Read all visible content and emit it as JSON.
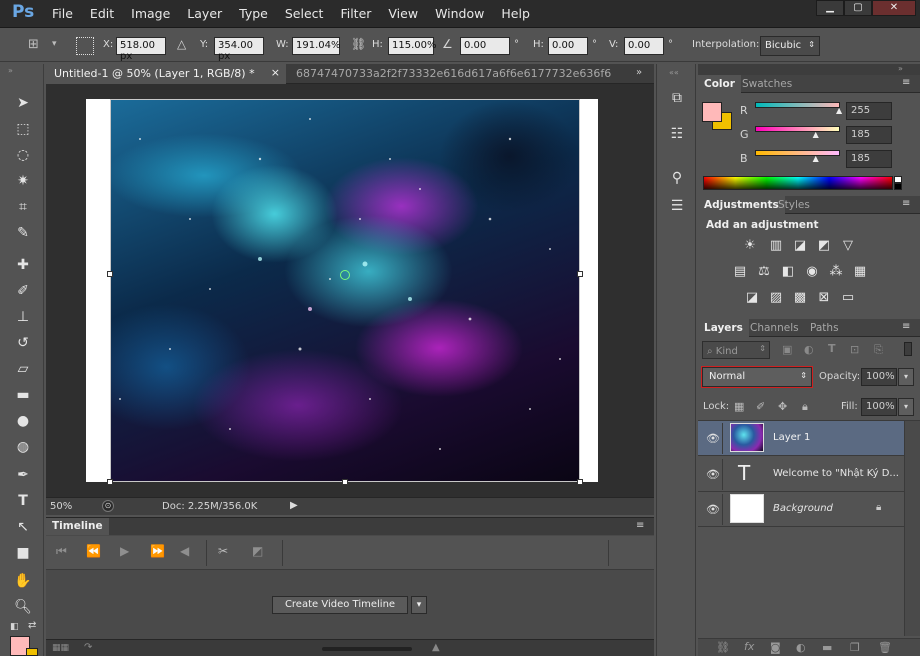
{
  "app": {
    "logo": "Ps"
  },
  "menu": [
    "File",
    "Edit",
    "Image",
    "Layer",
    "Type",
    "Select",
    "Filter",
    "View",
    "Window",
    "Help"
  ],
  "window_controls": {
    "minimize": "▁",
    "maximize": "▢",
    "close": "✕"
  },
  "options": {
    "x_label": "X:",
    "x_value": "518.00 px",
    "y_label": "Y:",
    "y_value": "354.00 px",
    "w_label": "W:",
    "w_value": "191.04%",
    "h_label": "H:",
    "h_value": "115.00%",
    "rot_value": "0.00",
    "deg1": "°",
    "hskew_label": "H:",
    "hskew_value": "0.00",
    "deg2": "°",
    "vskew_label": "V:",
    "vskew_value": "0.00",
    "deg3": "°",
    "interp_label": "Interpolation:",
    "interp_value": "Bicubic"
  },
  "document": {
    "tab_active": "Untitled-1 @ 50% (Layer 1, RGB/8) *",
    "tab_close": "×",
    "tab_second": "68747470733a2f2f73332e616d617a6f6e6177732e636f6",
    "zoom": "50%",
    "doc_info": "Doc: 2.25M/356.0K"
  },
  "timeline": {
    "title": "Timeline",
    "create_button": "Create Video Timeline"
  },
  "color_panel": {
    "tabs": [
      "Color",
      "Swatches"
    ],
    "r_label": "R",
    "r_value": "255",
    "g_label": "G",
    "g_value": "185",
    "b_label": "B",
    "b_value": "185",
    "fg_color": "#ffb9b9",
    "bg_color": "#f0c000",
    "r": 255,
    "g": 185,
    "b": 185
  },
  "adjustments_panel": {
    "tabs": [
      "Adjustments",
      "Styles"
    ],
    "heading": "Add an adjustment"
  },
  "layers_panel": {
    "tabs": [
      "Layers",
      "Channels",
      "Paths"
    ],
    "kind": "Kind",
    "blend_mode": "Normal",
    "opacity_label": "Opacity:",
    "opacity_value": "100%",
    "lock_label": "Lock:",
    "fill_label": "Fill:",
    "fill_value": "100%",
    "layers": [
      {
        "name": "Layer 1"
      },
      {
        "name": "Welcome to \"Nhật Ký D..."
      },
      {
        "name": "Background"
      }
    ]
  }
}
